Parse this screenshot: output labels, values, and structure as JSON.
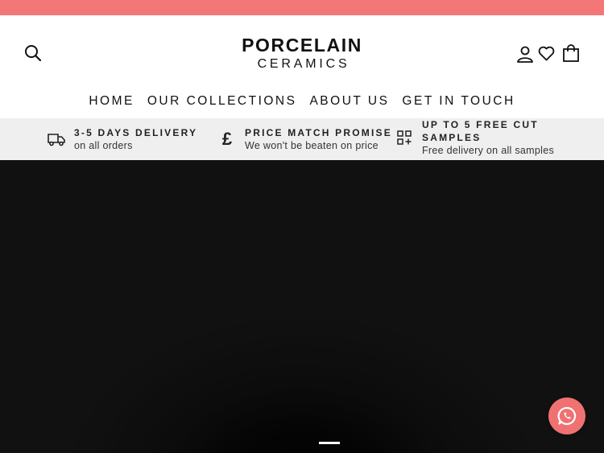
{
  "colors": {
    "announcement_bar": "#f37777",
    "usp_bar": "#efefef",
    "hero": "#111111",
    "whatsapp_button": "#f07171"
  },
  "header": {
    "logo_line1": "PORCELAIN",
    "logo_line2": "CERAMICS",
    "icons": {
      "search": "search-icon",
      "account": "user-icon",
      "wishlist": "heart-icon",
      "cart": "bag-icon"
    }
  },
  "nav": {
    "items": [
      {
        "label": "HOME"
      },
      {
        "label": "OUR COLLECTIONS"
      },
      {
        "label": "ABOUT US"
      },
      {
        "label": "GET IN TOUCH"
      }
    ]
  },
  "usps": [
    {
      "icon": "truck-icon",
      "title": "3-5 DAYS DELIVERY",
      "subtitle": "on all orders"
    },
    {
      "icon": "pound-icon",
      "title": "PRICE MATCH PROMISE",
      "subtitle": "We won't be beaten on price"
    },
    {
      "icon": "grid-plus-icon",
      "title_line1": "UP TO 5 FREE CUT",
      "title_line2": "SAMPLES",
      "subtitle": "Free delivery on all samples"
    }
  ],
  "floating": {
    "whatsapp_icon": "whatsapp-icon"
  }
}
